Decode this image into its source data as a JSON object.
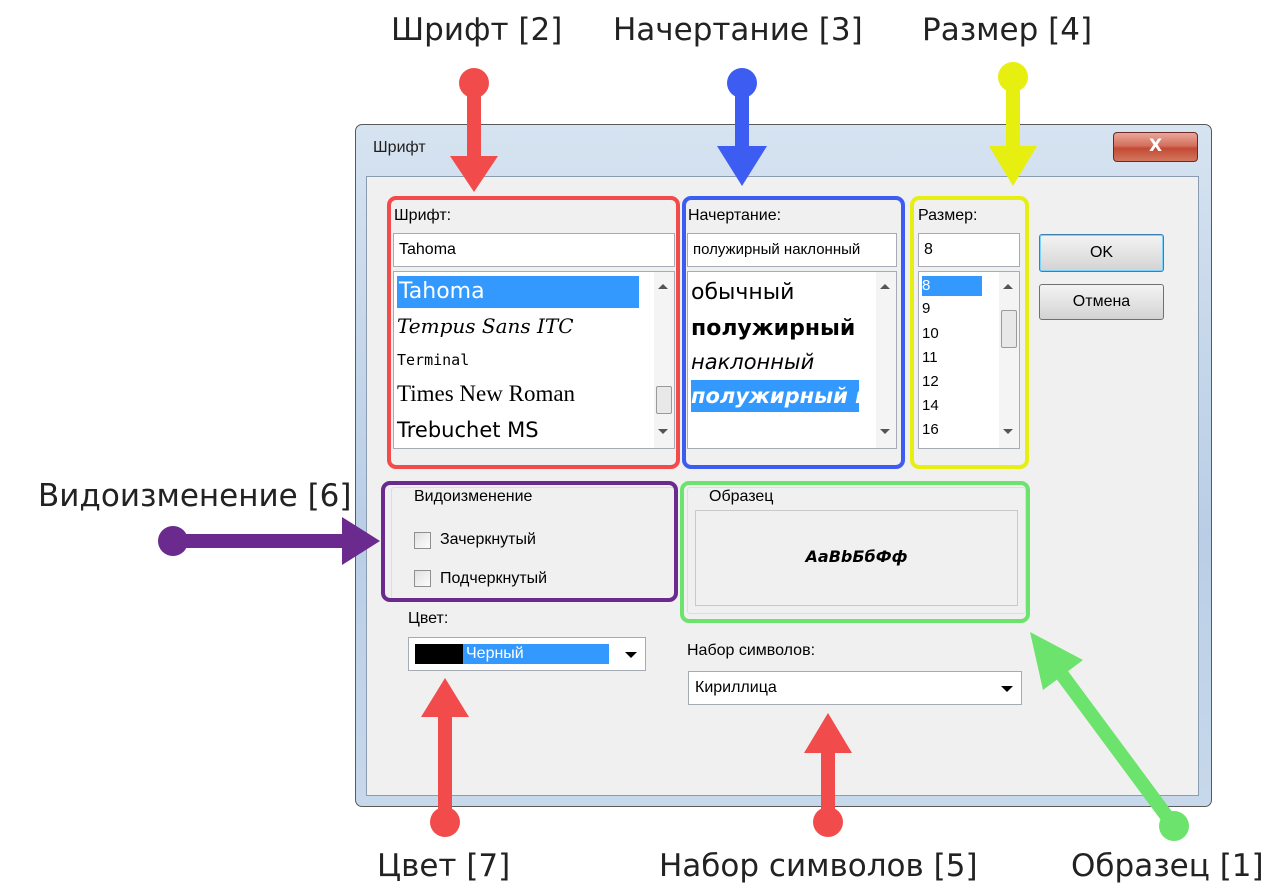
{
  "callouts": {
    "font": "Шрифт [2]",
    "style": "Начертание [3]",
    "size": "Размер [4]",
    "effects": "Видоизменение [6]",
    "color": "Цвет [7]",
    "charset": "Набор символов [5]",
    "sample": "Образец [1]"
  },
  "dialog": {
    "title": "Шрифт",
    "close_icon": "close-icon",
    "close_label": "X",
    "font": {
      "label": "Шрифт:",
      "value": "Tahoma",
      "items": [
        "Tahoma",
        "Tempus Sans ITC",
        "Terminal",
        "Times New Roman",
        "Trebuchet MS"
      ],
      "selected": "Tahoma"
    },
    "style": {
      "label": "Начертание:",
      "value": "полужирный наклонный",
      "items": [
        "обычный",
        "полужирный",
        "наклонный",
        "полужирный наклонный"
      ],
      "selected": "полужирный наклонный"
    },
    "size": {
      "label": "Размер:",
      "value": "8",
      "items": [
        "8",
        "9",
        "10",
        "11",
        "12",
        "14",
        "16"
      ],
      "selected": "8"
    },
    "ok_label": "OK",
    "cancel_label": "Отмена",
    "effects": {
      "legend": "Видоизменение",
      "strikeout": "Зачеркнутый",
      "underline": "Подчеркнутый"
    },
    "color": {
      "label": "Цвет:",
      "value": "Черный",
      "swatch": "#000000"
    },
    "sample": {
      "legend": "Образец",
      "text": "AaBbБбФф"
    },
    "charset": {
      "label": "Набор символов:",
      "value": "Кириллица"
    }
  },
  "colors": {
    "red": "#f24b4b",
    "blue": "#3d5cf2",
    "yellow": "#e6ef0f",
    "purple": "#6a2a8e",
    "green": "#6ce36c",
    "selection": "#3399ff"
  }
}
